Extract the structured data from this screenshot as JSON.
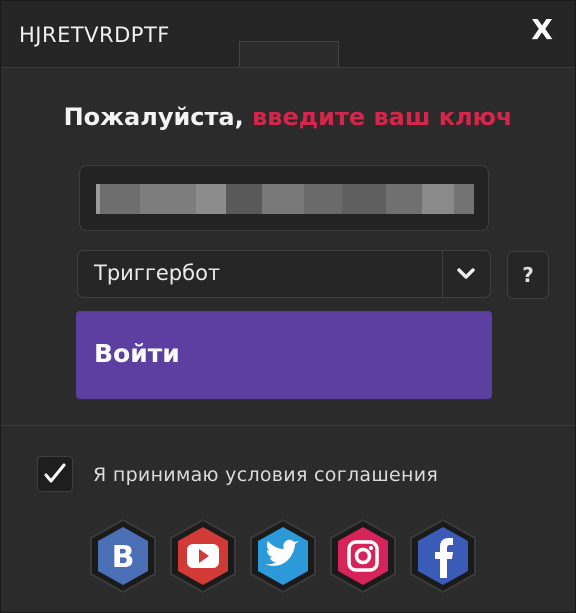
{
  "window": {
    "title": "HJRETVRDPTF",
    "close_label": "X"
  },
  "headline": {
    "white": "Пожалуйста, ",
    "red": "введите ваш ключ"
  },
  "key_field": {
    "value_blurred": true
  },
  "mode_select": {
    "selected": "Триггербот"
  },
  "help": {
    "label": "?"
  },
  "login": {
    "label": "Войти"
  },
  "terms": {
    "checked": true,
    "label": "Я принимаю условия соглашения"
  },
  "socials": [
    {
      "name": "vk",
      "color": "#4a6fb5"
    },
    {
      "name": "youtube",
      "color": "#d13a36"
    },
    {
      "name": "twitter",
      "color": "#2c9ad8"
    },
    {
      "name": "instagram",
      "color": "#d6245a"
    },
    {
      "name": "facebook",
      "color": "#3b5bb8"
    }
  ],
  "colors": {
    "accent_red": "#d6254a",
    "login_purple": "#5d3fa2"
  }
}
